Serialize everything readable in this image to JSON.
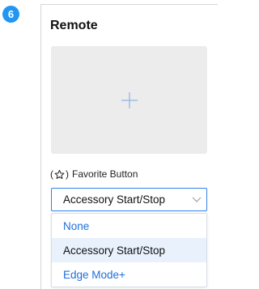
{
  "step": {
    "number": "6",
    "color": "#2196f3"
  },
  "panel": {
    "title": "Remote",
    "image_placeholder": {
      "icon": "plus-icon",
      "bg": "#ececec"
    }
  },
  "favorite": {
    "label_open": "(",
    "label_close": ")",
    "label_text": "Favorite Button",
    "icon": "star-outline-icon"
  },
  "select": {
    "value": "Accessory Start/Stop",
    "icon": "chevron-down-icon",
    "accent": "#2f80ed"
  },
  "dropdown": {
    "options": [
      {
        "label": "None",
        "selected": false
      },
      {
        "label": "Accessory Start/Stop",
        "selected": true
      },
      {
        "label": "Edge Mode+",
        "selected": false
      }
    ],
    "link_color": "#1f6fd8",
    "selected_bg": "#e9f1fc"
  }
}
